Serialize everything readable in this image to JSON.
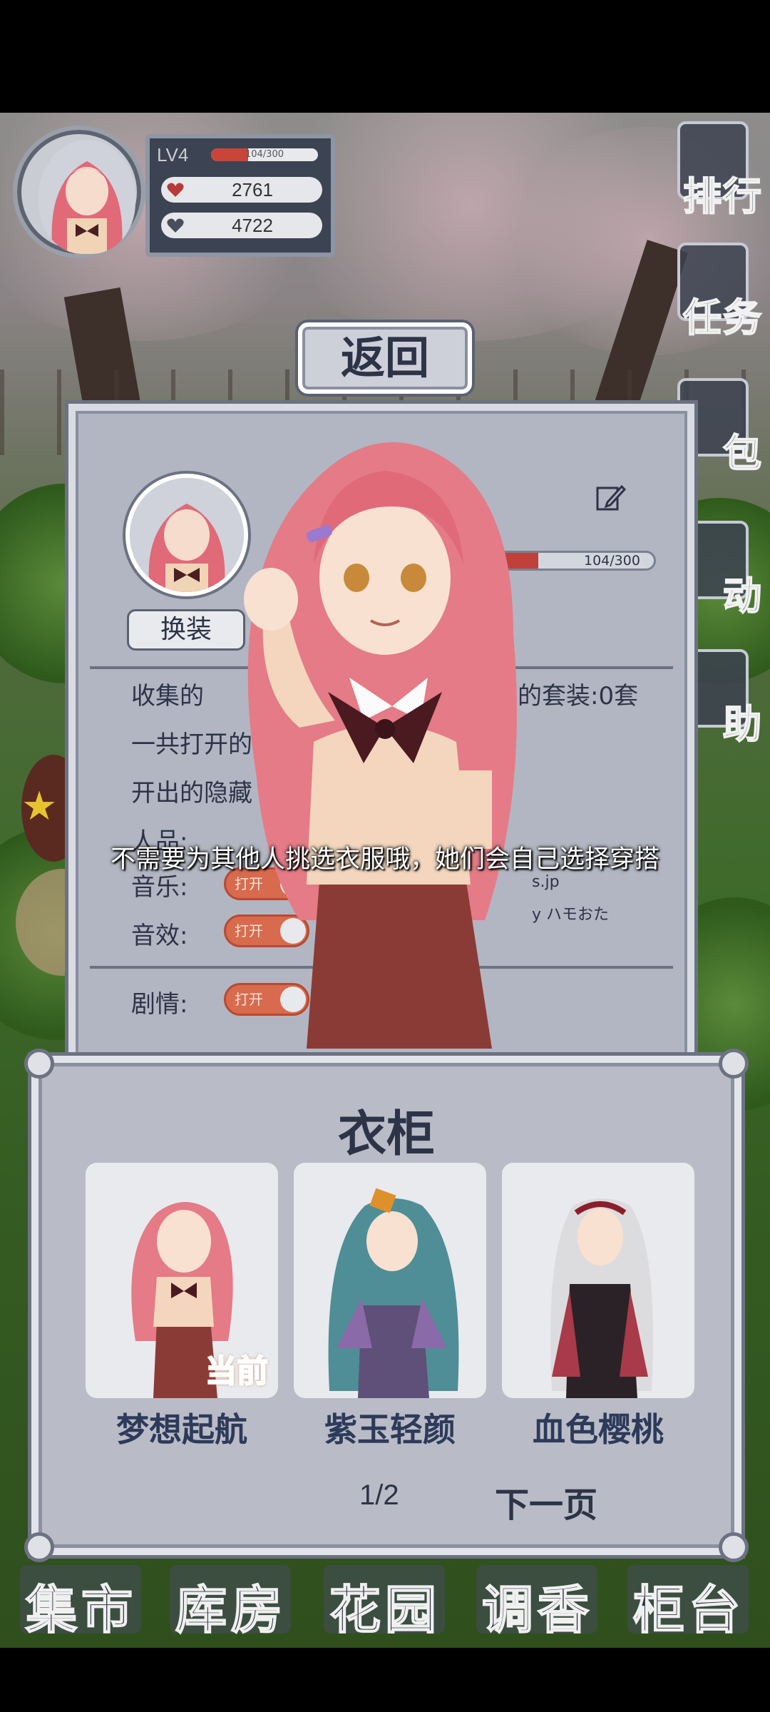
{
  "player": {
    "level_label": "LV4",
    "xp_text": "104/300",
    "xp_fraction": 0.347,
    "stat_1": "2761",
    "stat_2": "4722"
  },
  "side_menu": [
    "排行",
    "任务",
    "包",
    "动",
    "助"
  ],
  "return_button": "返回",
  "settings_panel": {
    "change_outfit_button": "换装",
    "xp_text": "104/300",
    "line_collect": "收集的",
    "line_collect_suffix": "的套装:0套",
    "line_opened": "一共打开的",
    "line_hidden": "开出的隐藏",
    "character_label": "人品:",
    "music_label": "音乐:",
    "sfx_label": "音效:",
    "story_label": "剧情:",
    "toggle_on": "打开",
    "credit_1": "s.jp",
    "credit_2": "y ハモおた"
  },
  "subtitle": "不需要为其他人挑选衣服哦，她们会自己选择穿搭",
  "wardrobe": {
    "title": "衣柜",
    "outfits": [
      {
        "name": "梦想起航",
        "current": true
      },
      {
        "name": "紫玉轻颜",
        "current": false
      },
      {
        "name": "血色樱桃",
        "current": false
      }
    ],
    "current_tag": "当前",
    "page_indicator": "1/2",
    "next_page": "下一页"
  },
  "bottom_nav": [
    "集市",
    "库房",
    "花园",
    "调香",
    "柜台"
  ],
  "colors": {
    "panel_ink": "#2d3448",
    "xp_red": "#c9453a",
    "toggle_orange": "#d86b4e"
  }
}
